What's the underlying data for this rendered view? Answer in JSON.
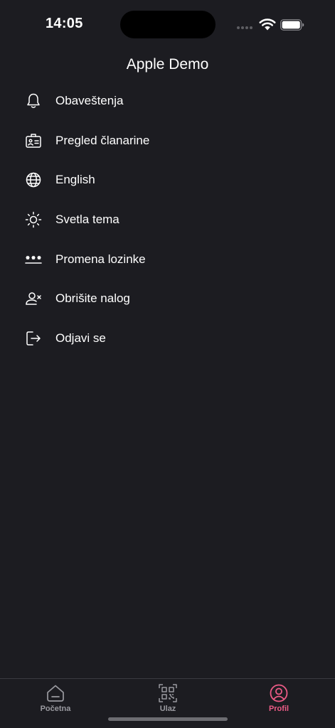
{
  "status_bar": {
    "time": "14:05",
    "wifi_icon": "wifi-icon",
    "battery_icon": "battery-icon"
  },
  "header": {
    "title": "Apple Demo"
  },
  "menu": {
    "items": [
      {
        "label": "Obaveštenja",
        "icon": "bell-icon"
      },
      {
        "label": "Pregled članarine",
        "icon": "id-card-icon"
      },
      {
        "label": "English",
        "icon": "globe-icon"
      },
      {
        "label": "Svetla tema",
        "icon": "sun-icon"
      },
      {
        "label": "Promena lozinke",
        "icon": "password-icon"
      },
      {
        "label": "Obrišite nalog",
        "icon": "user-remove-icon"
      },
      {
        "label": "Odjavi se",
        "icon": "logout-icon"
      }
    ]
  },
  "tab_bar": {
    "tabs": [
      {
        "label": "Početna",
        "icon": "home-icon",
        "active": false
      },
      {
        "label": "Ulaz",
        "icon": "qr-code-icon",
        "active": false
      },
      {
        "label": "Profil",
        "icon": "profile-icon",
        "active": true
      }
    ],
    "active_color": "#ec5b86",
    "inactive_color": "#9a9aa0"
  },
  "colors": {
    "background": "#1c1c21",
    "text": "#ffffff"
  }
}
